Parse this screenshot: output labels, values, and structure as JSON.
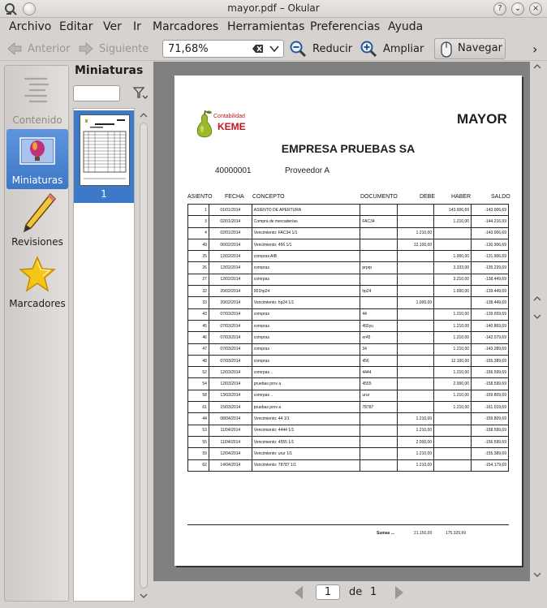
{
  "window": {
    "title": "mayor.pdf – Okular"
  },
  "menubar": [
    "Archivo",
    "Editar",
    "Ver",
    "Ir",
    "Marcadores",
    "Herramientas",
    "Preferencias",
    "Ayuda"
  ],
  "toolbar": {
    "prev_label": "Anterior",
    "next_label": "Siguiente",
    "zoom_value": "71,68%",
    "zoom_out_label": "Reducir",
    "zoom_in_label": "Ampliar",
    "browse_label": "Navegar",
    "more_glyph": "›"
  },
  "sidebar": {
    "items": [
      {
        "label": "Contenido",
        "icon": "contents-icon",
        "state": "disabled"
      },
      {
        "label": "Miniaturas",
        "icon": "thumbnails-icon",
        "state": "active"
      },
      {
        "label": "Revisiones",
        "icon": "pencil-icon",
        "state": "normal"
      },
      {
        "label": "Marcadores",
        "icon": "star-icon",
        "state": "normal"
      }
    ]
  },
  "thumbnails": {
    "heading": "Miniaturas",
    "page_number": "1"
  },
  "pagenav": {
    "current": "1",
    "of_label": "de",
    "total": "1"
  },
  "document": {
    "logo_caption": "Contabilidad",
    "logo_name": "KEME",
    "report_title": "MAYOR",
    "company": "EMPRESA PRUEBAS SA",
    "account_code": "40000001",
    "account_name": "Proveedor A",
    "columns": [
      "ASIENTO",
      "FECHA",
      "CONCEPTO",
      "DOCUMENTO",
      "DEBE",
      "HABER",
      "SALDO"
    ],
    "rows": [
      [
        "1",
        "01/01/2014",
        "ASIENTO DE APERTURA",
        "",
        "",
        "143.006,69",
        "-143.006,69"
      ],
      [
        "3",
        "02/01/2014",
        "Compra de mercaderías",
        "FAC34",
        "",
        "1.210,00",
        "-144.216,69"
      ],
      [
        "4",
        "02/01/2014",
        "Vencimiento: FAC34 1/1",
        "",
        "1.210,00",
        "",
        "-143.006,69"
      ],
      [
        "49",
        "06/02/2014",
        "Vencimiento: 456 1/1",
        "",
        "12.100,00",
        "",
        "-130.906,69"
      ],
      [
        "25",
        "12/02/2014",
        "compras AIB",
        "",
        "",
        "1.000,00",
        "-131.906,69"
      ],
      [
        "26",
        "12/02/2014",
        "compras",
        "prprp",
        "",
        "3.333,00",
        "-135.239,69"
      ],
      [
        "27",
        "12/02/2014",
        "comrpas",
        "",
        "",
        "3.210,00",
        "-138.449,69"
      ],
      [
        "32",
        "20/02/2014",
        "001hp24",
        "hp24",
        "",
        "1.000,00",
        "-139.449,69"
      ],
      [
        "33",
        "20/02/2014",
        "Vencimiento: hp24 1/1",
        "",
        "1.000,00",
        "",
        "-138.449,69"
      ],
      [
        "43",
        "07/03/2014",
        "compras",
        "44",
        "",
        "1.210,00",
        "-139.659,69"
      ],
      [
        "45",
        "07/03/2014",
        "compras",
        "455yu",
        "",
        "1.210,00",
        "-140.869,69"
      ],
      [
        "46",
        "07/03/2014",
        "compras",
        "er45",
        "",
        "1.210,00",
        "-142.079,69"
      ],
      [
        "47",
        "07/03/2014",
        "compras",
        "34",
        "",
        "1.210,00",
        "-143.289,69"
      ],
      [
        "48",
        "07/03/2014",
        "compras",
        "456",
        "",
        "12.100,00",
        "-155.389,69"
      ],
      [
        "52",
        "12/03/2014",
        "comrpas ..",
        "4444",
        "",
        "1.210,00",
        "-156.599,69"
      ],
      [
        "54",
        "12/03/2014",
        "pruebas prov a",
        "4555",
        "",
        "2.000,00",
        "-158.599,69"
      ],
      [
        "58",
        "13/03/2014",
        "comrpas ..",
        "urur",
        "",
        "1.210,00",
        "-159.809,69"
      ],
      [
        "61",
        "15/03/2014",
        "pruebas prov a",
        "78787",
        "",
        "1.210,00",
        "-161.019,69"
      ],
      [
        "44",
        "08/04/2014",
        "Vencimiento: 44 1/1",
        "",
        "1.210,00",
        "",
        "-159.809,69"
      ],
      [
        "53",
        "11/04/2014",
        "Vencimiento: 4444 1/1",
        "",
        "1.210,00",
        "",
        "-158.599,69"
      ],
      [
        "55",
        "11/04/2014",
        "Vencimiento: 4555 1/1",
        "",
        "2.000,00",
        "",
        "-156.599,69"
      ],
      [
        "59",
        "12/04/2014",
        "Vencimiento: urur 1/1",
        "",
        "1.210,00",
        "",
        "-155.389,69"
      ],
      [
        "62",
        "14/04/2014",
        "Vencimiento: 78787 1/1",
        "",
        "1.210,00",
        "",
        "-154.179,69"
      ]
    ],
    "totals": {
      "label": "Sumas ...",
      "debe": "21.150,00",
      "haber": "175.329,69"
    }
  },
  "colors": {
    "selection": "#3d79c9",
    "doc_background": "#808080",
    "logo_red": "#c4161c",
    "pear_green": "#9cba2a"
  }
}
